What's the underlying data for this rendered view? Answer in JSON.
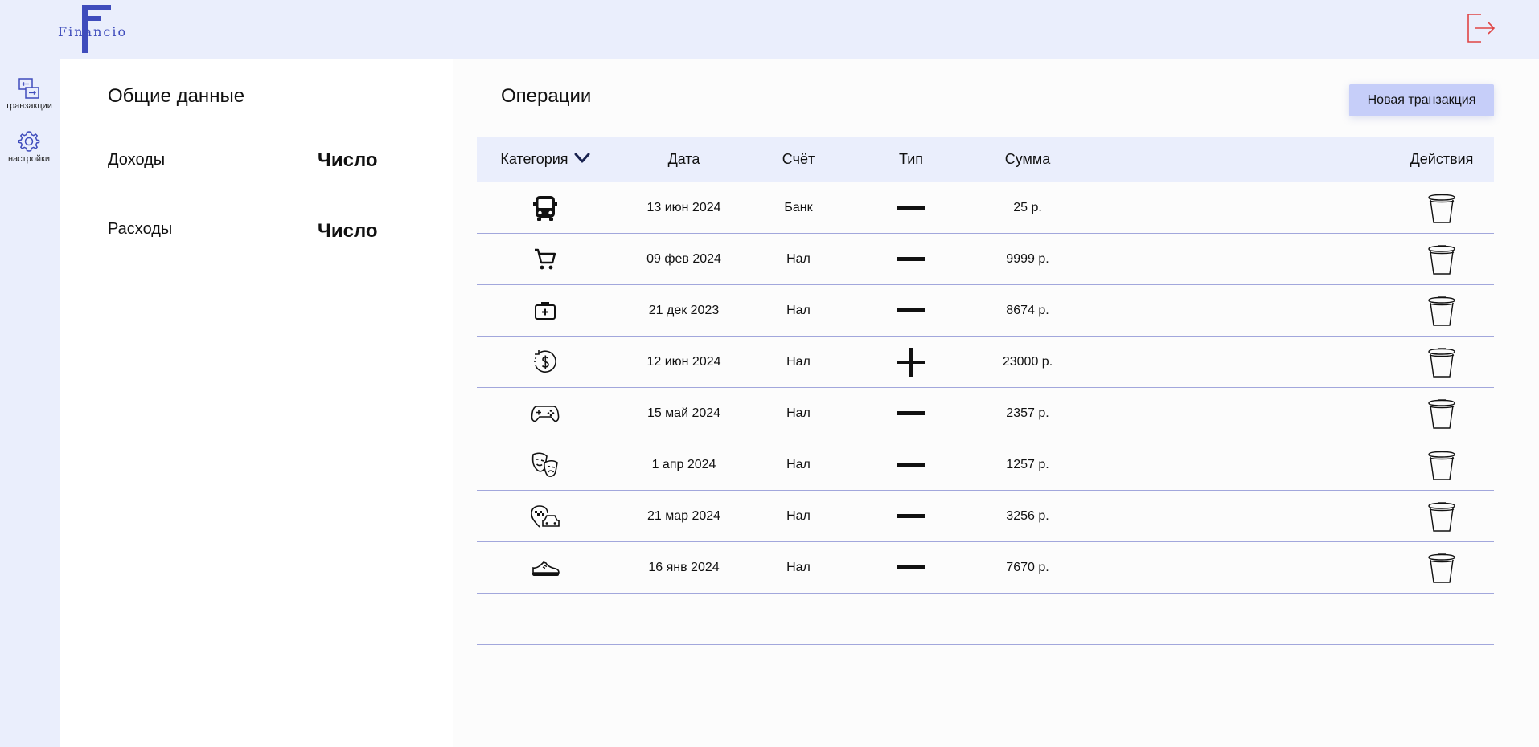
{
  "app": {
    "logo_text": "Financio"
  },
  "sidebar": {
    "items": [
      {
        "label": "транзакции",
        "icon": "transactions-icon"
      },
      {
        "label": "настройки",
        "icon": "settings-gear-icon"
      }
    ]
  },
  "summary": {
    "title": "Общие данные",
    "income_label": "Доходы",
    "income_value": "Число",
    "expense_label": "Расходы",
    "expense_value": "Число"
  },
  "operations": {
    "title": "Операции",
    "new_button": "Новая транзакция",
    "columns": {
      "category": "Категория",
      "date": "Дата",
      "account": "Счёт",
      "type": "Тип",
      "amount": "Сумма",
      "actions": "Действия"
    },
    "rows": [
      {
        "category_icon": "bus-icon",
        "date": "13 июн 2024",
        "account": "Банк",
        "type": "minus",
        "amount": "25 р."
      },
      {
        "category_icon": "shopping-cart-icon",
        "date": "09 фев 2024",
        "account": "Нал",
        "type": "minus",
        "amount": "9999 р."
      },
      {
        "category_icon": "medical-kit-icon",
        "date": "21 дек 2023",
        "account": "Нал",
        "type": "minus",
        "amount": "8674 р."
      },
      {
        "category_icon": "refund-dollar-icon",
        "date": "12 июн 2024",
        "account": "Нал",
        "type": "plus",
        "amount": "23000 р."
      },
      {
        "category_icon": "gamepad-icon",
        "date": "15 май 2024",
        "account": "Нал",
        "type": "minus",
        "amount": "2357 р."
      },
      {
        "category_icon": "theater-masks-icon",
        "date": "1 апр 2024",
        "account": "Нал",
        "type": "minus",
        "amount": "1257 р."
      },
      {
        "category_icon": "taxi-icon",
        "date": "21 мар 2024",
        "account": "Нал",
        "type": "minus",
        "amount": "3256 р."
      },
      {
        "category_icon": "sneaker-icon",
        "date": "16 янв 2024",
        "account": "Нал",
        "type": "minus",
        "amount": "7670 р."
      }
    ],
    "empty_rows": 2
  },
  "colors": {
    "background": "#eaeefc",
    "brand": "#3f4cbc",
    "button": "#c6cef9",
    "row_border": "#a2a7dc",
    "logout": "#e04545"
  }
}
